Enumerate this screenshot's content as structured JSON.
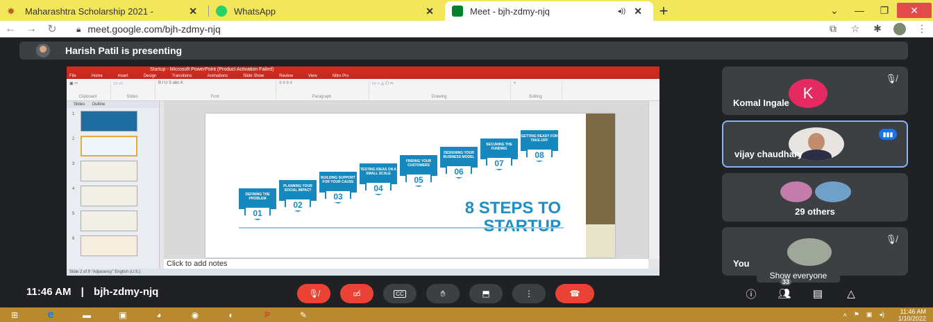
{
  "browser": {
    "tabs": [
      {
        "title": "Maharashtra Scholarship 2021 - ",
        "active": false
      },
      {
        "title": "WhatsApp",
        "active": false
      },
      {
        "title": "Meet - bjh-zdmy-njq",
        "active": true
      }
    ],
    "url": "meet.google.com/bjh-zdmy-njq"
  },
  "banner": {
    "text": "Harish Patil is presenting"
  },
  "presentation": {
    "title_bar": "Startup - Microsoft PowerPoint (Product Activation Failed)",
    "menu": [
      "File",
      "Home",
      "Insert",
      "Design",
      "Transitions",
      "Animations",
      "Slide Show",
      "Review",
      "View",
      "Nitro Pro"
    ],
    "ribbon_groups": [
      "Clipboard",
      "Slides",
      "Font",
      "Paragraph",
      "Drawing",
      "Editing"
    ],
    "panel_tabs": [
      "Slides",
      "Outline"
    ],
    "slide_title": "8 STEPS TO STARTUP",
    "steps": [
      {
        "num": "01",
        "label": "DEFINING THE PROBLEM"
      },
      {
        "num": "02",
        "label": "PLANNING YOUR SOCIAL IMPACT"
      },
      {
        "num": "03",
        "label": "BUILDING SUPPORT FOR YOUR CAUSE"
      },
      {
        "num": "04",
        "label": "TESTING IDEAS ON A SMALL SCALE"
      },
      {
        "num": "05",
        "label": "FINDING YOUR CUSTOMERS"
      },
      {
        "num": "06",
        "label": "DESIGNING YOUR BUSINESS MODEL"
      },
      {
        "num": "07",
        "label": "SECURING THE FUNDING"
      },
      {
        "num": "08",
        "label": "GETTING READY FOR TAKE-OFF"
      }
    ],
    "notes_placeholder": "Click to add notes",
    "status": "Slide 2 of 9   \"Adjacency\"   English (U.S.)"
  },
  "participants": [
    {
      "name": "Komal Ingale",
      "initial": "K",
      "muted": true
    },
    {
      "name": "vijay chaudhary",
      "speaking": true
    },
    {
      "name": "29 others"
    },
    {
      "name": "You",
      "muted": true
    }
  ],
  "tooltip": "Show everyone",
  "bottom": {
    "time": "11:46 AM",
    "separator": "|",
    "meeting_code": "bjh-zdmy-njq",
    "people_count": "33"
  },
  "taskbar": {
    "time": "11:46 AM",
    "date": "1/10/2022"
  },
  "colors": {
    "end_call": "#ea4335",
    "speaker": "#1a73e8",
    "avatar_k": "#e52a62"
  }
}
